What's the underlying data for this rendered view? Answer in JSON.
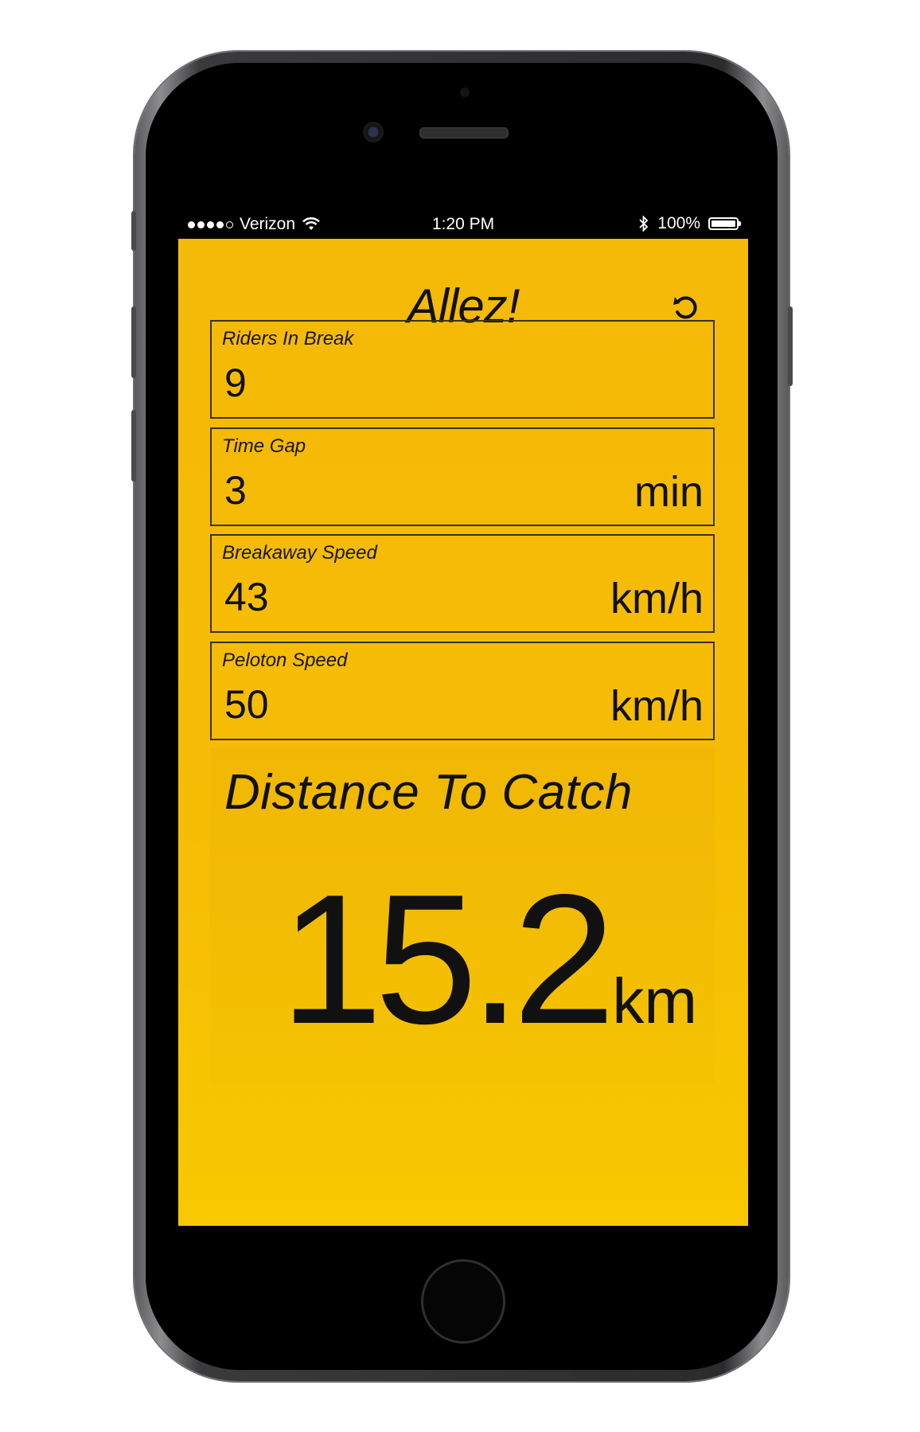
{
  "status_bar": {
    "carrier": "Verizon",
    "time": "1:20 PM",
    "battery": "100%",
    "signal_dots_filled": 4,
    "signal_dots_total": 5,
    "battery_level": 1.0
  },
  "app": {
    "title": "Allez!",
    "reset_icon": "refresh-icon",
    "background_color": "#f5b907",
    "fields": [
      {
        "label": "Riders In Break",
        "value": "9",
        "unit": ""
      },
      {
        "label": "Time Gap",
        "value": "3",
        "unit": "min"
      },
      {
        "label": "Breakaway Speed",
        "value": "43",
        "unit": "km/h"
      },
      {
        "label": "Peloton Speed",
        "value": "50",
        "unit": "km/h"
      }
    ],
    "result": {
      "label": "Distance To Catch",
      "value": "15.2",
      "unit": "km"
    }
  }
}
